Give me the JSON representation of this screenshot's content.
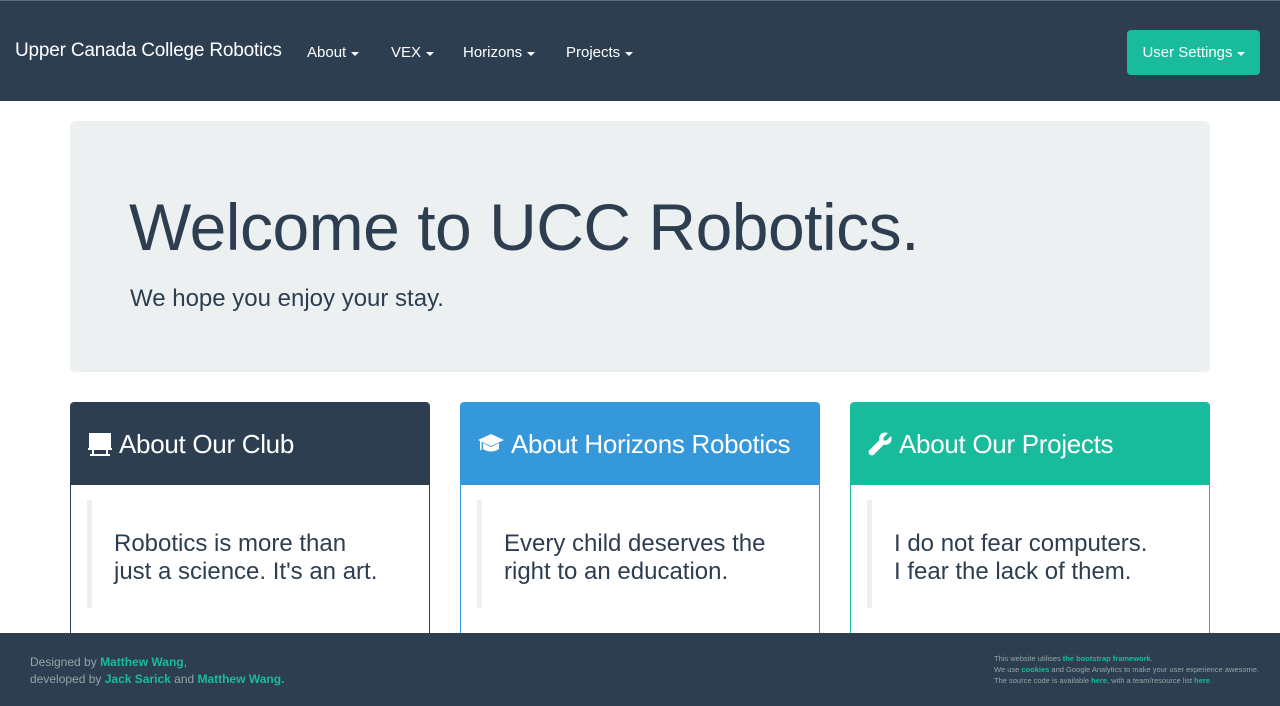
{
  "navbar": {
    "brand": "Upper Canada College Robotics",
    "menus": [
      {
        "label": "About"
      },
      {
        "label": "VEX"
      },
      {
        "label": "Horizons"
      },
      {
        "label": "Projects"
      }
    ],
    "user_settings": "User Settings"
  },
  "jumbotron": {
    "title": "Welcome to UCC Robotics.",
    "subtitle": "We hope you enjoy your stay."
  },
  "panels": [
    {
      "title": "About Our Club",
      "icon": "easel-icon",
      "color": "#2c3e50",
      "quote": [
        "Robotics is more than",
        "just a science. It's an art."
      ]
    },
    {
      "title": "About Horizons Robotics",
      "icon": "graduation-cap-icon",
      "color": "#3498db",
      "quote": [
        "Every child deserves the",
        "right to an education."
      ]
    },
    {
      "title": "About Our Projects",
      "icon": "wrench-icon",
      "color": "#18bc9c",
      "quote": [
        "I do not fear computers.",
        "I fear the lack of them."
      ]
    }
  ],
  "footer": {
    "designed_by": "Designed by",
    "designer": "Matthew Wang",
    "comma": ",",
    "developed_by": "developed by",
    "dev1": "Jack Sarick",
    "and": "and",
    "dev2": "Matthew Wang",
    "period": ".",
    "line1_pre": "This website utilises",
    "line1_link": "the bootstrap framework",
    "line2_pre": "We use",
    "line2_link": "cookies",
    "line2_post": "and Google Analytics to make your user experience awesome.",
    "line3_pre": "The source code is available",
    "line3_link1": "here",
    "line3_mid": ", with a team/resource list",
    "line3_link2": "here"
  },
  "colors": {
    "primary": "#2c3e50",
    "info": "#3498db",
    "success": "#18bc9c",
    "jumbotron_bg": "#ecf0f1"
  }
}
